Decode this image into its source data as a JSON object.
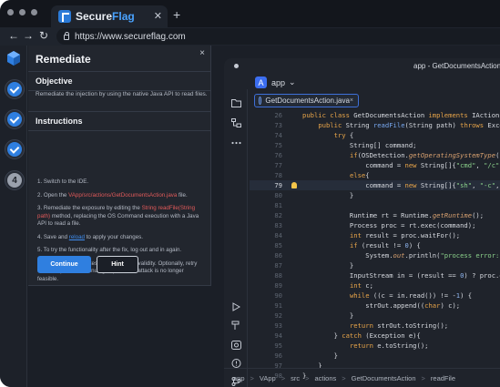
{
  "browser": {
    "tab_brand_prefix": "Secure",
    "tab_brand_suffix": "Flag",
    "url": "https://www.secureflag.com",
    "new_tab_label": "+",
    "tab_close_label": "✕",
    "back_label": "←",
    "forward_label": "→",
    "reload_label": "↻"
  },
  "panel": {
    "title": "Remediate",
    "close_label": "×",
    "objective_header": "Objective",
    "objective_text": "Remediate the injection by using the native Java API to read files.",
    "instructions_header": "Instructions",
    "steps": [
      {
        "n": "1.",
        "text": "Switch to the IDE."
      },
      {
        "n": "2.",
        "pre": "Open the ",
        "code": "VApp/src/actions/GetDocumentsAction.java",
        "post": " file."
      },
      {
        "n": "3.",
        "pre": "Remediate the exposure by editing the ",
        "code": "String readFile(String path)",
        "post": " method, replacing the OS Command execution with a Java API to read a file."
      },
      {
        "n": "4.",
        "pre": "Save and ",
        "link": "reload",
        "post": " to apply your changes."
      },
      {
        "n": "5.",
        "text": "To try the functionality after the fix, log out and in again."
      },
      {
        "n": "6.",
        "text": "Press Continue to test your solution's validity. Optionally, retry the hack prior to continuing to prove the attack is no longer feasible."
      }
    ],
    "continue_label": "Continue",
    "hint_label": "Hint"
  },
  "steps_rail": {
    "current_step": "4"
  },
  "ide": {
    "window_title": "app - GetDocumentsAction",
    "project_initial": "A",
    "project_name": "app",
    "project_chevron": "⌄",
    "file_tab": "GetDocumentsAction.java",
    "file_tab_close": "×",
    "current_line": "79",
    "lines": [
      {
        "n": "26",
        "html": "<span class=\"kw\">public class</span> GetDocumentsAction <span class=\"kw\">implements</span> IAction {"
      },
      {
        "n": "73",
        "html": "    <span class=\"kw\">public</span> String <span class=\"fn\">readFile</span>(String path) <span class=\"kw\">throws</span> Exception {"
      },
      {
        "n": "74",
        "html": "        <span class=\"kw\">try</span> {"
      },
      {
        "n": "75",
        "html": "            String[] command;"
      },
      {
        "n": "76",
        "html": "            <span class=\"kw\">if</span>(OSDetection.<span class=\"it\">getOperatingSystemType</span>().equals"
      },
      {
        "n": "77",
        "html": "                command = <span class=\"kw\">new</span> String[]{<span class=\"str\">\"cmd\"</span>, <span class=\"str\">\"/c\"</span>, <span class=\"str\">\"type\"</span>"
      },
      {
        "n": "78",
        "html": "            <span class=\"kw\">else</span>{"
      },
      {
        "n": "79",
        "html": "                command = <span class=\"kw\">new</span> String[]{<span class=\"str\">\"sh\"</span>, <span class=\"str\">\"-c\"</span>, <span class=\"str\">\"cat\"</span>"
      },
      {
        "n": "80",
        "html": "            }"
      },
      {
        "n": "81",
        "html": ""
      },
      {
        "n": "82",
        "html": "            Runtime rt = Runtime.<span class=\"it\">getRuntime</span>();"
      },
      {
        "n": "83",
        "html": "            Process proc = rt.exec(command);"
      },
      {
        "n": "84",
        "html": "            <span class=\"kw\">int</span> result = proc.waitFor();"
      },
      {
        "n": "85",
        "html": "            <span class=\"kw\">if</span> (result != <span class=\"cls\">0</span>) {"
      },
      {
        "n": "86",
        "html": "                System.<span class=\"it\">out</span>.println(<span class=\"str\">\"process error: \"</span> + r"
      },
      {
        "n": "87",
        "html": "            }"
      },
      {
        "n": "88",
        "html": "            InputStream in = (result == <span class=\"cls\">0</span>) ? proc.getInp"
      },
      {
        "n": "89",
        "html": "            <span class=\"kw\">int</span> c;"
      },
      {
        "n": "90",
        "html": "            <span class=\"kw\">while</span> ((c = in.read()) != -<span class=\"cls\">1</span>) {"
      },
      {
        "n": "91",
        "html": "                strOut.append((<span class=\"kw\">char</span>) c);"
      },
      {
        "n": "92",
        "html": "            }"
      },
      {
        "n": "93",
        "html": "            <span class=\"kw\">return</span> strOut.toString();"
      },
      {
        "n": "94",
        "html": "        } <span class=\"kw\">catch</span> (Exception e){"
      },
      {
        "n": "95",
        "html": "            <span class=\"kw\">return</span> e.toString();"
      },
      {
        "n": "96",
        "html": "        }"
      },
      {
        "n": "97",
        "html": "    }"
      },
      {
        "n": "98",
        "html": "}"
      }
    ],
    "breadcrumb": [
      "app",
      "VApp",
      "src",
      "actions",
      "GetDocumentsAction",
      "readFile"
    ],
    "breadcrumb_sep": ">"
  },
  "colors": {
    "accent": "#2f7fe0",
    "code_string": "#8bd18b",
    "code_keyword": "#e7a449",
    "code_highlight": "#e15a5a"
  }
}
